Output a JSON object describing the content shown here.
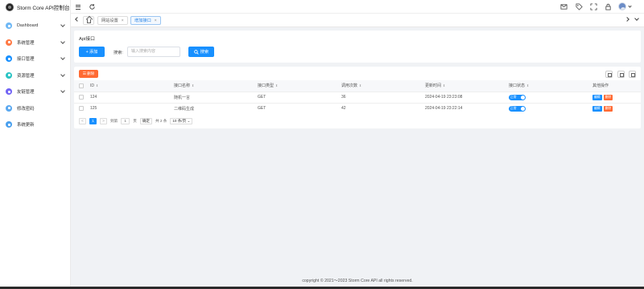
{
  "app": {
    "title": "Storm Core API控制台"
  },
  "sidebar": {
    "items": [
      {
        "label": "Dashboard",
        "color": "#6fb8f5",
        "expandable": true
      },
      {
        "label": "系统管理",
        "color": "#ff7a45",
        "expandable": true
      },
      {
        "label": "接口管理",
        "color": "#1890ff",
        "expandable": true
      },
      {
        "label": "资源管理",
        "color": "#2bc4c4",
        "expandable": true
      },
      {
        "label": "友链管理",
        "color": "#7264f5",
        "expandable": true
      },
      {
        "label": "修改密码",
        "color": "#5aa8f0",
        "expandable": false
      },
      {
        "label": "系统更新",
        "color": "#4aa0ee",
        "expandable": false
      }
    ]
  },
  "tabs": [
    {
      "label": "网站设置",
      "close": "×"
    },
    {
      "label": "增加接口",
      "close": "×"
    }
  ],
  "panel": {
    "title": "Api接口",
    "add_label": "+ 添加",
    "search_label": "搜索:",
    "search_placeholder": "输入搜索内容",
    "search_button": "搜索",
    "delete_label": "删除"
  },
  "table": {
    "headers": [
      "ID",
      "接口名称",
      "接口类型",
      "调用次数",
      "更新时间",
      "接口状态",
      "其他操作"
    ],
    "rows": [
      {
        "id": "124",
        "name": "随机一言",
        "type": "GET",
        "calls": "36",
        "updated": "2024-04-19 23:23:08",
        "status": "正常",
        "edit": "编辑",
        "del": "删除"
      },
      {
        "id": "125",
        "name": "二维码生成",
        "type": "GET",
        "calls": "42",
        "updated": "2024-04-19 23:22:14",
        "status": "正常",
        "edit": "编辑",
        "del": "删除"
      }
    ]
  },
  "pager": {
    "prev": "<",
    "current": "1",
    "next": ">",
    "goto_label": "到第",
    "goto_value": "1",
    "page_unit": "页",
    "confirm": "确定",
    "total": "共 2 条",
    "page_size": "10 条/页"
  },
  "footer": {
    "text": "copyright © 2021～2023 Storm Core API all rights reserved."
  },
  "colors": {
    "primary": "#1890ff",
    "danger": "#ff6a33"
  }
}
